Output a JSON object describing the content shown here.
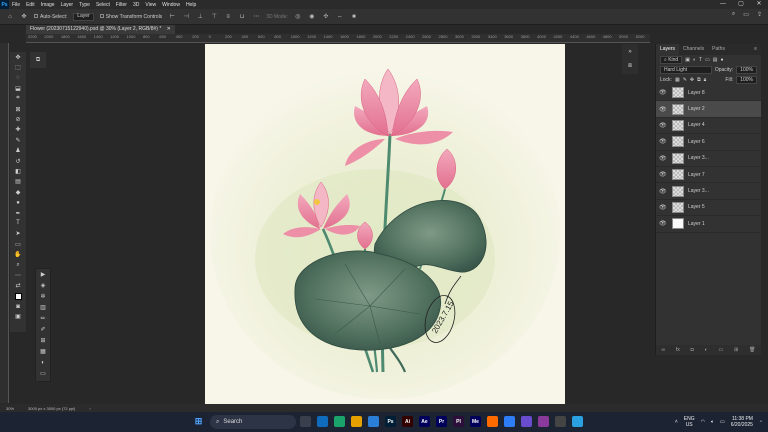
{
  "menu": {
    "app_badge": "Ps",
    "items": [
      "File",
      "Edit",
      "Image",
      "Layer",
      "Type",
      "Select",
      "Filter",
      "3D",
      "View",
      "Window",
      "Help"
    ]
  },
  "options": {
    "auto_select": "Auto-Select:",
    "target": "Layer",
    "transform": "Show Transform Controls",
    "mode3d": "3D Mode:"
  },
  "doc": {
    "tab_title": "Flower (20230715122940).psd @ 30% (Layer 2, RGB/8#) *"
  },
  "rulers": {
    "h": [
      "2200",
      "2000",
      "1800",
      "1600",
      "1400",
      "1200",
      "1000",
      "800",
      "600",
      "400",
      "200",
      "0",
      "200",
      "400",
      "600",
      "800",
      "1000",
      "1200",
      "1400",
      "1600",
      "1800",
      "2000",
      "2200",
      "2400",
      "2600",
      "2800",
      "3000",
      "3200",
      "3400",
      "3600",
      "3800",
      "4000",
      "4200",
      "4400",
      "4600",
      "4800",
      "5000",
      "5200"
    ]
  },
  "artwork": {
    "signature": "2023.7.15"
  },
  "panel": {
    "tabs": [
      "Layers",
      "Channels",
      "Paths"
    ],
    "kind_label": "Kind",
    "blend_mode": "Hard Light",
    "opacity_label": "Opacity:",
    "opacity": "100%",
    "lock_label": "Lock:",
    "fill_label": "Fill:",
    "fill": "100%",
    "layers": [
      {
        "name": "Layer 8",
        "selected": false,
        "thumb": "checker"
      },
      {
        "name": "Layer 2",
        "selected": true,
        "thumb": "checker"
      },
      {
        "name": "Layer 4",
        "selected": false,
        "thumb": "checker"
      },
      {
        "name": "Layer 6",
        "selected": false,
        "thumb": "checker"
      },
      {
        "name": "Layer 3...",
        "selected": false,
        "thumb": "checker"
      },
      {
        "name": "Layer 7",
        "selected": false,
        "thumb": "checker"
      },
      {
        "name": "Layer 3...",
        "selected": false,
        "thumb": "checker"
      },
      {
        "name": "Layer 5",
        "selected": false,
        "thumb": "checker"
      },
      {
        "name": "Layer 1",
        "selected": false,
        "thumb": "white"
      }
    ]
  },
  "status": {
    "zoom": "30%",
    "size": "3000 px x 3000 px (72 ppi)"
  },
  "taskbar": {
    "search": "Search",
    "apps": [
      {
        "label": "",
        "color": "#3a3f4d"
      },
      {
        "label": "",
        "color": "#0f6cbd"
      },
      {
        "label": "",
        "color": "#1aa36b"
      },
      {
        "label": "",
        "color": "#e5a100"
      },
      {
        "label": "",
        "color": "#2b7fd9"
      },
      {
        "label": "Ps",
        "color": "#001e36"
      },
      {
        "label": "Ai",
        "color": "#330000"
      },
      {
        "label": "Ae",
        "color": "#00005b"
      },
      {
        "label": "Pr",
        "color": "#00005b"
      },
      {
        "label": "Pl",
        "color": "#2b0f3a"
      },
      {
        "label": "Me",
        "color": "#00005b"
      },
      {
        "label": "",
        "color": "#ff6a00"
      },
      {
        "label": "",
        "color": "#2f7df6"
      },
      {
        "label": "",
        "color": "#6a4ccf"
      },
      {
        "label": "",
        "color": "#8a3a9a"
      },
      {
        "label": "",
        "color": "#444"
      },
      {
        "label": "",
        "color": "#2aa0e0"
      }
    ],
    "lang": "ENG",
    "region": "US",
    "time": "11:38 PM",
    "date": "6/20/2025"
  }
}
